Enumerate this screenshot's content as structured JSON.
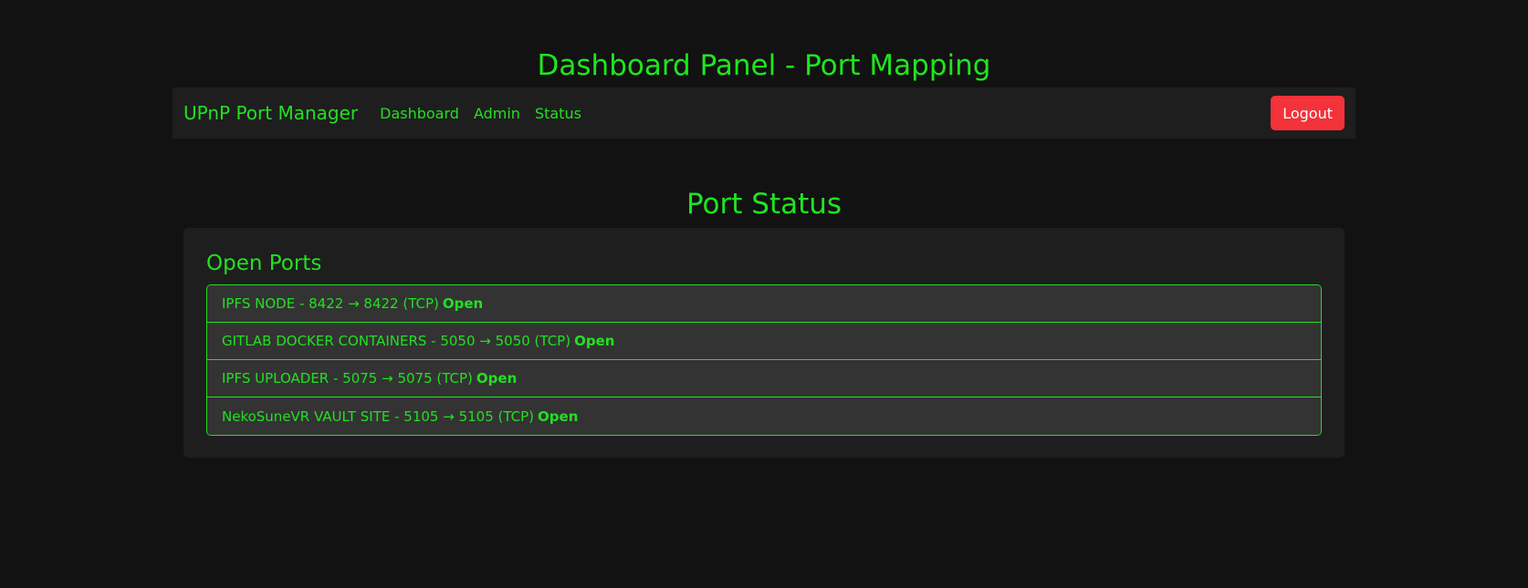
{
  "page": {
    "title": "Dashboard Panel - Port Mapping"
  },
  "navbar": {
    "brand": "UPnP Port Manager",
    "links": [
      "Dashboard",
      "Admin",
      "Status"
    ],
    "logout_label": "Logout"
  },
  "main": {
    "section_title": "Port Status",
    "card_title": "Open Ports",
    "ports": [
      {
        "text": "IPFS NODE - 8422 → 8422 (TCP)",
        "status": "Open"
      },
      {
        "text": "GITLAB DOCKER CONTAINERS - 5050 → 5050 (TCP)",
        "status": "Open"
      },
      {
        "text": "IPFS UPLOADER - 5075 → 5075 (TCP)",
        "status": "Open"
      },
      {
        "text": "NekoSuneVR VAULT SITE - 5105 → 5105 (TCP)",
        "status": "Open"
      }
    ]
  },
  "colors": {
    "background": "#121212",
    "panel": "#1e1e1e",
    "accent_green": "#22e022",
    "logout_red": "#f3323a",
    "list_item_bg": "#333333"
  }
}
